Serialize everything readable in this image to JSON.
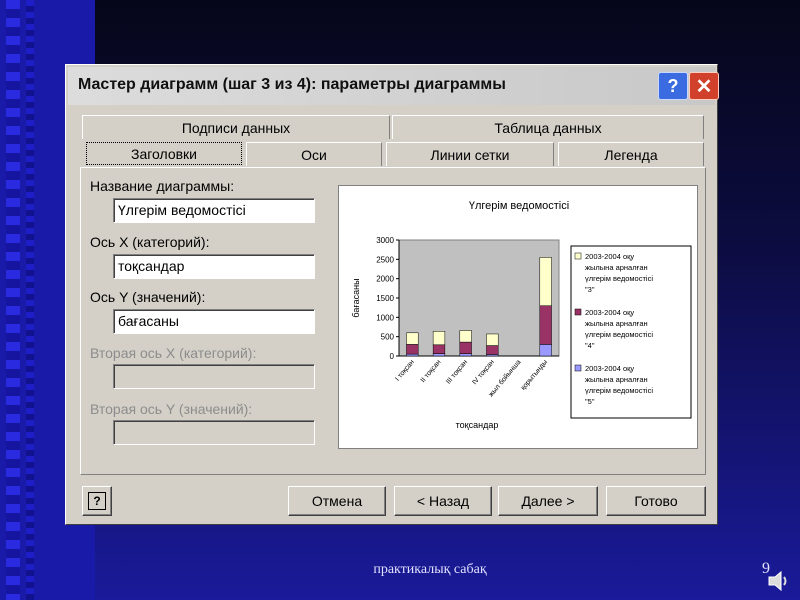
{
  "dialog": {
    "title": "Мастер диаграмм (шаг 3 из 4): параметры диаграммы",
    "help_symbol": "?",
    "close_symbol": "✕"
  },
  "tabs_top": [
    "Подписи данных",
    "Таблица данных"
  ],
  "tabs_bottom": [
    "Заголовки",
    "Оси",
    "Линии сетки",
    "Легенда"
  ],
  "active_tab": "Заголовки",
  "fields": {
    "chart_title_label": "Название диаграммы:",
    "chart_title_value": "Үлгерім ведомостісі",
    "x_axis_label": "Ось X (категорий):",
    "x_axis_value": "тоқсандар",
    "y_axis_label": "Ось Y (значений):",
    "y_axis_value": "бағасаны",
    "x2_axis_label": "Вторая ось X (категорий):",
    "y2_axis_label": "Вторая ось Y (значений):"
  },
  "buttons": {
    "help": "?",
    "cancel": "Отмена",
    "back": "< Назад",
    "next": "Далее >",
    "finish": "Готово"
  },
  "footer": {
    "text": "практикалық сабақ",
    "page_number": "9"
  },
  "colors": {
    "series3": "#ffffcc",
    "series4": "#993366",
    "series5": "#9999ff",
    "plot_bg": "#c0c0c0"
  },
  "chart_data": {
    "type": "bar",
    "stacked": true,
    "title": "Үлгерім ведомостісі",
    "xlabel": "тоқсандар",
    "ylabel": "бағасаны",
    "ylim": [
      0,
      3000
    ],
    "yticks": [
      0,
      500,
      1000,
      1500,
      2000,
      2500,
      3000
    ],
    "categories": [
      "I тоқсан",
      "II тоқсан",
      "III тоқсан",
      "IV тоқсан",
      "жыл бойынша",
      "қорытынды"
    ],
    "series": [
      {
        "name": "2003-2004 оқу жылына арналған үлгерім ведомостісі \"5\"",
        "color": "#9999ff",
        "values": [
          50,
          60,
          60,
          40,
          0,
          300
        ]
      },
      {
        "name": "2003-2004 оқу жылына арналған үлгерім ведомостісі \"4\"",
        "color": "#993366",
        "values": [
          250,
          230,
          300,
          230,
          0,
          1000
        ]
      },
      {
        "name": "2003-2004 оқу жылына арналған үлгерім ведомостісі \"3\"",
        "color": "#ffffcc",
        "values": [
          300,
          350,
          300,
          300,
          0,
          1250
        ]
      }
    ],
    "legend_position": "right",
    "grid": false
  }
}
